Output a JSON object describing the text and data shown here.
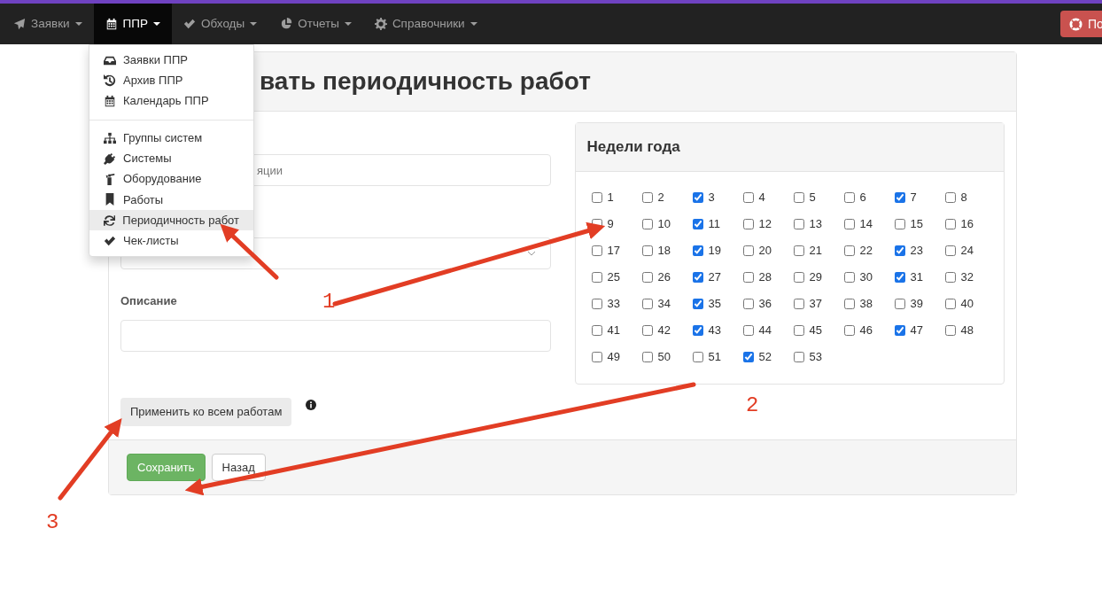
{
  "navbar": {
    "items": [
      {
        "label": "Заявки",
        "selected": false
      },
      {
        "label": "ППР",
        "selected": true
      },
      {
        "label": "Обходы",
        "selected": false
      },
      {
        "label": "Отчеты",
        "selected": false
      },
      {
        "label": "Справочники",
        "selected": false
      }
    ],
    "help_button": {
      "label": "По"
    }
  },
  "dropdown": {
    "groups": [
      [
        {
          "label": "Заявки ППР",
          "selected": false
        },
        {
          "label": "Архив ППР",
          "selected": false
        },
        {
          "label": "Календарь ППР",
          "selected": false
        }
      ],
      [
        {
          "label": "Группы систем",
          "selected": false
        },
        {
          "label": "Системы",
          "selected": false
        },
        {
          "label": "Оборудование",
          "selected": false
        },
        {
          "label": "Работы",
          "selected": false
        },
        {
          "label": "Периодичность работ",
          "selected": true
        },
        {
          "label": "Чек-листы",
          "selected": false
        }
      ]
    ]
  },
  "page": {
    "title": "вать периодичность работ",
    "fields": [
      {
        "kind": "input",
        "placeholder": "яции"
      },
      {
        "kind": "select"
      },
      {
        "kind": "input",
        "label": "Описание"
      }
    ],
    "apply_button": "Применить ко всем работам",
    "weeks_panel": {
      "title": "Недели года",
      "weeks": [
        {
          "label": "1",
          "checked": false
        },
        {
          "label": "2",
          "checked": false
        },
        {
          "label": "3",
          "checked": true
        },
        {
          "label": "4",
          "checked": false
        },
        {
          "label": "5",
          "checked": false
        },
        {
          "label": "6",
          "checked": false
        },
        {
          "label": "7",
          "checked": true
        },
        {
          "label": "8",
          "checked": false
        },
        {
          "label": "9",
          "checked": false
        },
        {
          "label": "10",
          "checked": false
        },
        {
          "label": "11",
          "checked": true
        },
        {
          "label": "12",
          "checked": false
        },
        {
          "label": "13",
          "checked": false
        },
        {
          "label": "14",
          "checked": false
        },
        {
          "label": "15",
          "checked": false
        },
        {
          "label": "16",
          "checked": false
        },
        {
          "label": "17",
          "checked": false
        },
        {
          "label": "18",
          "checked": false
        },
        {
          "label": "19",
          "checked": true
        },
        {
          "label": "20",
          "checked": false
        },
        {
          "label": "21",
          "checked": false
        },
        {
          "label": "22",
          "checked": false
        },
        {
          "label": "23",
          "checked": true
        },
        {
          "label": "24",
          "checked": false
        },
        {
          "label": "25",
          "checked": false
        },
        {
          "label": "26",
          "checked": false
        },
        {
          "label": "27",
          "checked": true
        },
        {
          "label": "28",
          "checked": false
        },
        {
          "label": "29",
          "checked": false
        },
        {
          "label": "30",
          "checked": false
        },
        {
          "label": "31",
          "checked": true
        },
        {
          "label": "32",
          "checked": false
        },
        {
          "label": "33",
          "checked": false
        },
        {
          "label": "34",
          "checked": false
        },
        {
          "label": "35",
          "checked": true
        },
        {
          "label": "36",
          "checked": false
        },
        {
          "label": "37",
          "checked": false
        },
        {
          "label": "38",
          "checked": false
        },
        {
          "label": "39",
          "checked": false
        },
        {
          "label": "40",
          "checked": false
        },
        {
          "label": "41",
          "checked": false
        },
        {
          "label": "42",
          "checked": false
        },
        {
          "label": "43",
          "checked": true
        },
        {
          "label": "44",
          "checked": false
        },
        {
          "label": "45",
          "checked": false
        },
        {
          "label": "46",
          "checked": false
        },
        {
          "label": "47",
          "checked": true
        },
        {
          "label": "48",
          "checked": false
        },
        {
          "label": "49",
          "checked": false
        },
        {
          "label": "50",
          "checked": false
        },
        {
          "label": "51",
          "checked": false
        },
        {
          "label": "52",
          "checked": true
        },
        {
          "label": "53",
          "checked": false
        }
      ]
    },
    "footer_buttons": [
      {
        "label": "Сохранить",
        "kind": "primary"
      },
      {
        "label": "Назад",
        "kind": "default"
      }
    ]
  },
  "annotations": [
    {
      "number": "1"
    },
    {
      "number": "2"
    },
    {
      "number": "3"
    }
  ]
}
